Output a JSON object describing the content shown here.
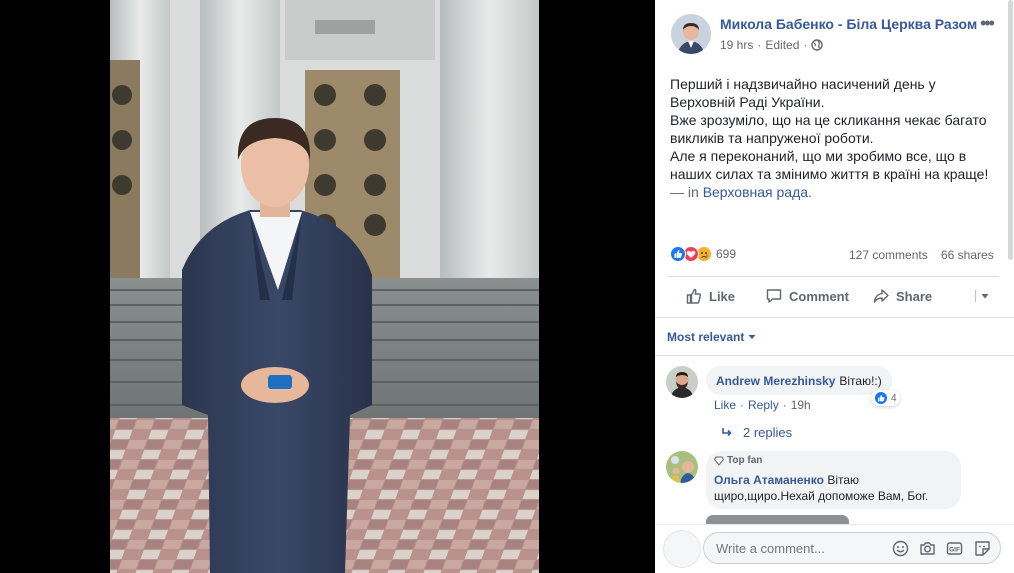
{
  "post": {
    "author": "Микола Бабенко - Біла Церква Разом",
    "time": "19 hrs",
    "edited_label": "Edited",
    "menu_icon": "more-horizontal-icon",
    "privacy_icon": "globe-icon",
    "text_lines": [
      "Перший і надзвичайно насичений день у",
      "Верховній Раді України.",
      "Вже зрозуміло, що на це скликання чекає багато",
      "викликів та напруженої роботи.",
      "Але я переконаний, що ми зробимо все, що в",
      "наших силах та змінимо життя в країні на краще!"
    ],
    "location_prefix": "— in",
    "location": "Верховная рада",
    "location_suffix": ".",
    "reactions_count": "699",
    "reaction_icons": [
      "like-reaction-icon",
      "love-reaction-icon",
      "sad-reaction-icon"
    ],
    "comments_count": "127 comments",
    "shares_count": "66 shares"
  },
  "actions": {
    "like": "Like",
    "comment": "Comment",
    "share": "Share"
  },
  "filter": {
    "label": "Most relevant"
  },
  "comments": [
    {
      "author": "Andrew Merezhinsky",
      "text": "Вітаю!:)",
      "like_label": "Like",
      "reply_label": "Reply",
      "time": "19h",
      "reaction_count": "4",
      "replies_label": "2 replies"
    },
    {
      "badge": "Top fan",
      "author": "Ольга Атаманенко",
      "text_first": "Вітаю",
      "text_second": "щиро,щиро.Нехай допоможе Вам, Бог."
    }
  ],
  "composer": {
    "placeholder": "Write a comment...",
    "icons": [
      "emoji-icon",
      "camera-icon",
      "gif-icon",
      "sticker-icon"
    ]
  },
  "colors": {
    "link": "#385898",
    "like_blue": "#1877f2",
    "love_red": "#f33e58",
    "sad_yellow": "#f7b125",
    "background": "#000000"
  }
}
